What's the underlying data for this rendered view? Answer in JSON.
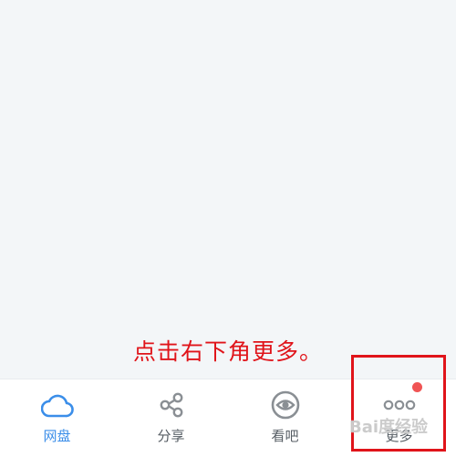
{
  "annotation_text": "点击右下角更多。",
  "tabs": [
    {
      "label": "网盘",
      "icon": "cloud-icon",
      "active": true
    },
    {
      "label": "分享",
      "icon": "share-icon",
      "active": false
    },
    {
      "label": "看吧",
      "icon": "eye-icon",
      "active": false
    },
    {
      "label": "更多",
      "icon": "more-icon",
      "active": false,
      "has_badge": true
    }
  ],
  "watermark": "Bai度经验",
  "colors": {
    "background": "#f3f6f8",
    "tabbar": "#ffffff",
    "active": "#3b8ee9",
    "inactive_icon": "#8a8f94",
    "inactive_label": "#555c63",
    "badge": "#f05454",
    "annotation": "#e0141a"
  }
}
